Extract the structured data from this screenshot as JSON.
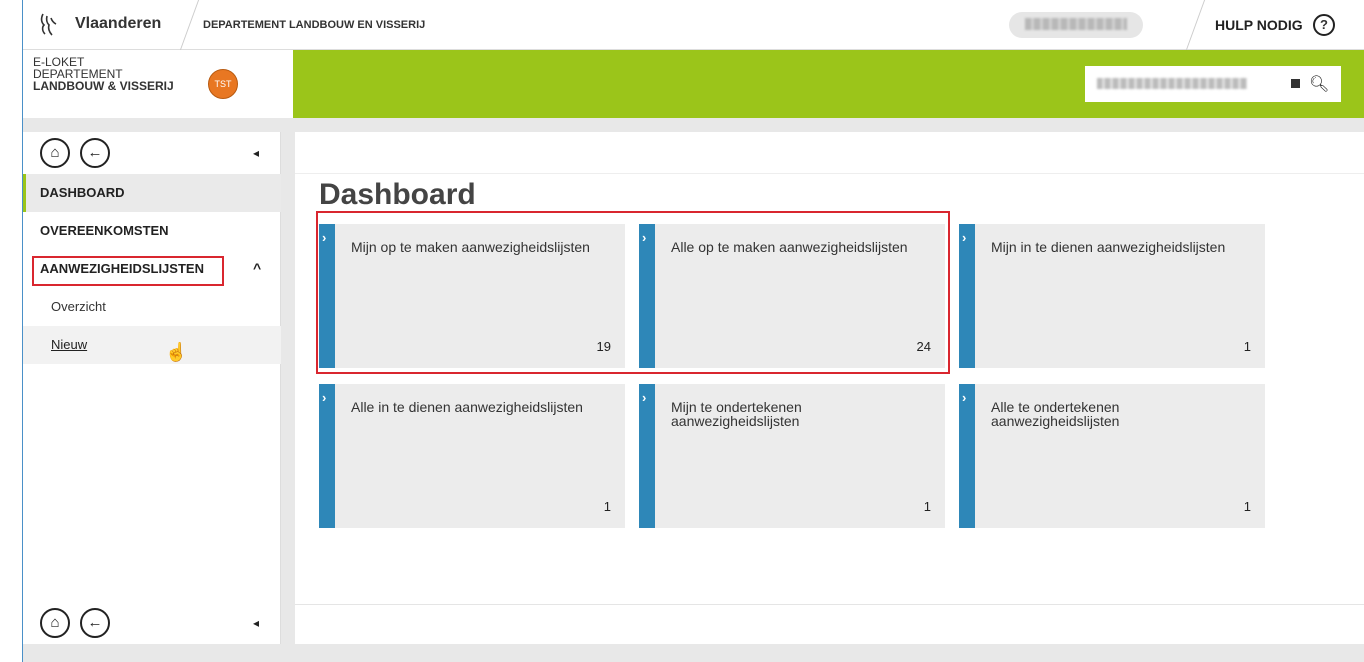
{
  "topbar": {
    "brand": "Vlaanderen",
    "department": "DEPARTEMENT LANDBOUW EN VISSERIJ",
    "help": "HULP NODIG",
    "help_icon": "?"
  },
  "header": {
    "line1": "E-LOKET",
    "line2": "DEPARTEMENT",
    "line3": "LANDBOUW & VISSERIJ",
    "badge": "TST"
  },
  "sidebar": {
    "home_icon": "⌂",
    "back_icon": "←",
    "collapse_icon": "◂",
    "items": [
      {
        "label": "DASHBOARD"
      },
      {
        "label": "OVEREENKOMSTEN"
      },
      {
        "label": "AANWEZIGHEIDSLIJSTEN"
      }
    ],
    "expand_icon": "^",
    "sub_items": [
      {
        "label": "Overzicht"
      },
      {
        "label": "Nieuw"
      }
    ]
  },
  "main": {
    "title": "Dashboard",
    "tiles": [
      {
        "label": "Mijn op te maken aanwezigheidslijsten",
        "count": "19"
      },
      {
        "label": "Alle op te maken aanwezigheidslijsten",
        "count": "24"
      },
      {
        "label": "Mijn in te dienen aanwezigheidslijsten",
        "count": "1"
      },
      {
        "label": "Alle in te dienen aanwezigheidslijsten",
        "count": "1"
      },
      {
        "label": "Mijn te ondertekenen aanwezigheidslijsten",
        "count": "1"
      },
      {
        "label": "Alle te ondertekenen aanwezigheidslijsten",
        "count": "1"
      }
    ]
  },
  "colors": {
    "brand_green": "#9bc51a",
    "tile_blue": "#2e87b8",
    "highlight_red": "#d9262f",
    "badge_orange": "#e87722"
  }
}
